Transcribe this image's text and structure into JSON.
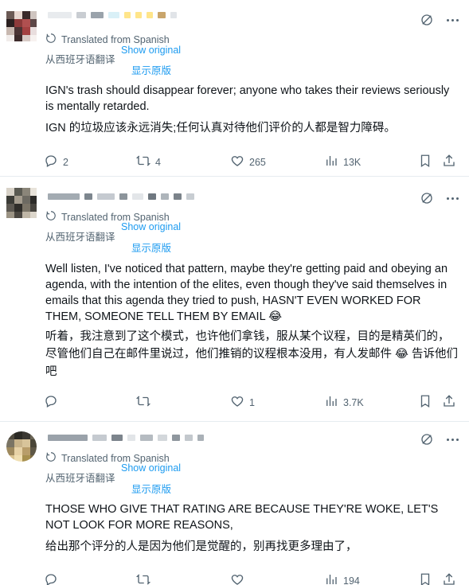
{
  "translation": {
    "translated_from": "Translated from Spanish",
    "translated_from_zh": "从西班牙语翻译",
    "show_original": "Show original",
    "show_original_zh": "显示原版"
  },
  "tweets": [
    {
      "body_en": "IGN's trash should disappear forever; anyone who takes their reviews seriously is mentally retarded.",
      "body_zh": "IGN 的垃圾应该永远消失;任何认真对待他们评价的人都是智力障碍。",
      "replies": "2",
      "reposts": "4",
      "likes": "265",
      "views": "13K"
    },
    {
      "body_en": "Well listen, I've noticed that pattern, maybe they're getting paid and obeying an agenda, with the intention of the elites, even though they've said themselves in emails that this agenda they tried to push, HASN'T EVEN WORKED FOR THEM, SOMEONE TELL THEM BY EMAIL 😂",
      "body_zh": "听着，我注意到了这个模式，也许他们拿钱，服从某个议程，目的是精英们的，尽管他们自己在邮件里说过，他们推销的议程根本没用，有人发邮件 😂 告诉他们吧",
      "replies": "",
      "reposts": "",
      "likes": "1",
      "views": "3.7K"
    },
    {
      "body_en": "THOSE WHO GIVE THAT RATING ARE BECAUSE THEY'RE WOKE, LET'S NOT LOOK FOR MORE REASONS,",
      "body_zh": "给出那个评分的人是因为他们是觉醒的，别再找更多理由了，",
      "replies": "",
      "reposts": "",
      "likes": "",
      "views": "194"
    }
  ],
  "icons": [
    "translate-icon",
    "grok-icon",
    "more-icon",
    "reply-icon",
    "repost-icon",
    "like-icon",
    "views-icon",
    "bookmark-icon",
    "share-icon"
  ],
  "colors": {
    "accent": "#1d9bf0",
    "muted": "#536471",
    "text": "#0f1419",
    "divider": "#e6ecf0"
  }
}
